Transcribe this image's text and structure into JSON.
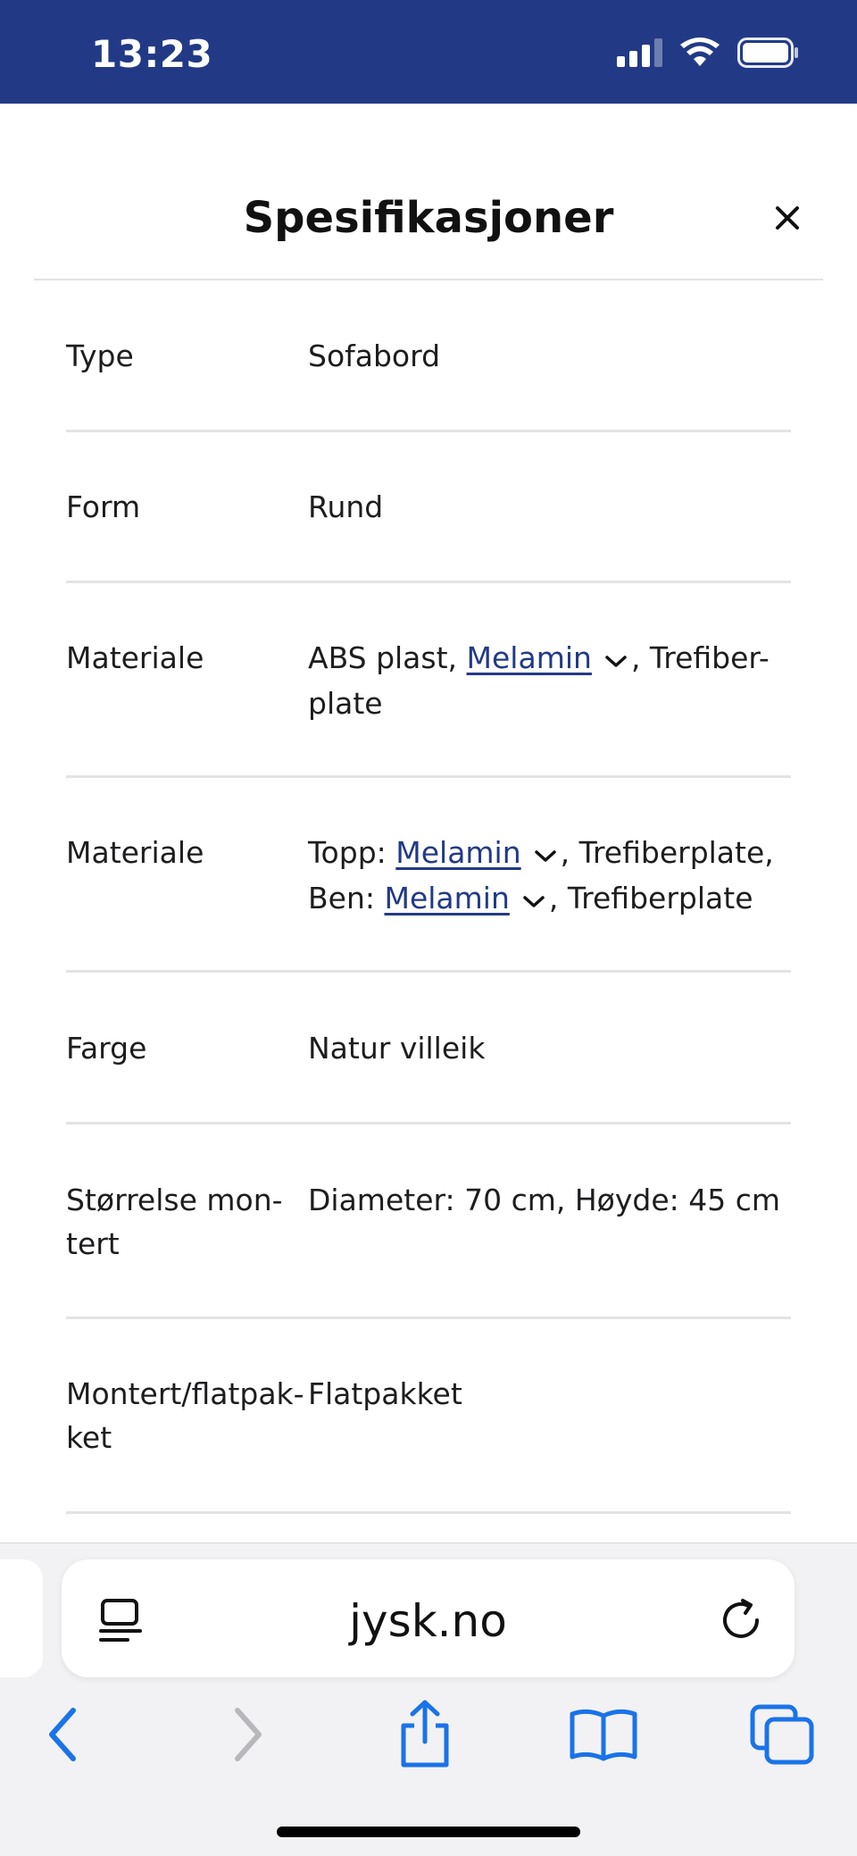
{
  "status_bar": {
    "time": "13:23",
    "icons": [
      "cellular-signal-icon",
      "wifi-icon",
      "battery-icon"
    ]
  },
  "sheet": {
    "title": "Spesifikasjoner",
    "close_icon": "close-icon"
  },
  "specs": {
    "type": {
      "label": "Type",
      "value": "Sofabord"
    },
    "form": {
      "label": "Form",
      "value": "Rund"
    },
    "materiale1": {
      "label": "Materiale",
      "prefix": "ABS plast, ",
      "link": "Melamin",
      "suffix": ", Trefiber-",
      "line2": "plate"
    },
    "materiale2": {
      "label": "Materiale",
      "prefix1": "Topp: ",
      "link1": "Melamin",
      "suffix1": ", Trefiberplate,",
      "prefix2": "Ben: ",
      "link2": "Melamin",
      "suffix2": ", Trefiberplate"
    },
    "farge": {
      "label": "Farge",
      "value": "Natur villeik"
    },
    "storrelse": {
      "label_line1": "Størrelse mon-",
      "label_line2": "tert",
      "value": "Diameter: 70 cm, Høyde: 45 cm"
    },
    "montert": {
      "label_line1": "Montert/flatpak-",
      "label_line2": "ket",
      "value": "Flatpakket"
    }
  },
  "browser": {
    "url": "jysk.no",
    "reader_icon": "reader-mode-icon",
    "reload_icon": "reload-icon",
    "toolbar_icons": [
      "back-arrow-icon",
      "forward-arrow-icon",
      "share-icon",
      "bookmarks-icon",
      "tabs-icon"
    ]
  },
  "colors": {
    "status_bar_bg": "#223a86",
    "link": "#223a86",
    "ios_blue": "#1a73e8",
    "divider": "#e3e3e3"
  }
}
